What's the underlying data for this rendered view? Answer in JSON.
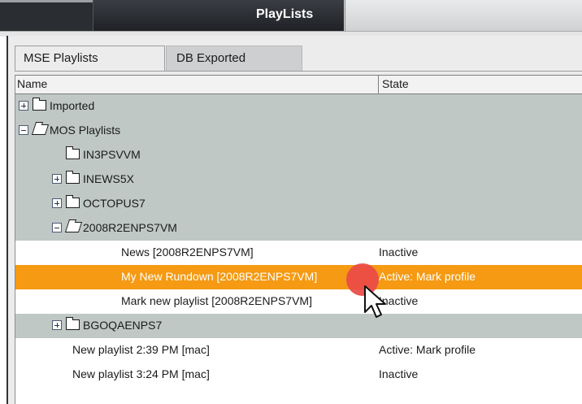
{
  "header": {
    "title": "PlayLists"
  },
  "tabs": [
    {
      "label": "MSE Playlists",
      "active": true
    },
    {
      "label": "DB Exported",
      "active": false
    }
  ],
  "columns": {
    "name": "Name",
    "state": "State"
  },
  "rows": [
    {
      "label": "Imported",
      "state": "",
      "type": "folder",
      "expander": "plus"
    },
    {
      "label": "MOS Playlists",
      "state": "",
      "type": "folder-open",
      "expander": "minus"
    },
    {
      "label": "IN3PSVVM",
      "state": "",
      "type": "folder",
      "expander": "none"
    },
    {
      "label": "INEWS5X",
      "state": "",
      "type": "folder",
      "expander": "plus"
    },
    {
      "label": "OCTOPUS7",
      "state": "",
      "type": "folder",
      "expander": "plus"
    },
    {
      "label": "2008R2ENPS7VM",
      "state": "",
      "type": "folder-open",
      "expander": "minus"
    },
    {
      "label": "News [2008R2ENPS7VM]",
      "state": "Inactive",
      "type": "playlist"
    },
    {
      "label": "My New Rundown [2008R2ENPS7VM]",
      "state": "Active: Mark profile",
      "type": "playlist",
      "selected": true
    },
    {
      "label": "Mark new playlist [2008R2ENPS7VM]",
      "state": "Inactive",
      "type": "playlist"
    },
    {
      "label": "BGOQAENPS7",
      "state": "",
      "type": "folder",
      "expander": "plus"
    },
    {
      "label": "New playlist 2:39 PM [mac]",
      "state": "Active: Mark profile",
      "type": "playlist"
    },
    {
      "label": "New playlist 3:24 PM [mac]",
      "state": "Inactive",
      "type": "playlist"
    }
  ],
  "colors": {
    "group_row": "#bfc8c5",
    "selected_row": "#f59a12",
    "click_marker": "#e94a46"
  },
  "icons": {
    "expand": "plus-box-icon",
    "collapse": "minus-box-icon",
    "folder": "folder-icon",
    "pointer": "mouse-pointer-icon"
  }
}
